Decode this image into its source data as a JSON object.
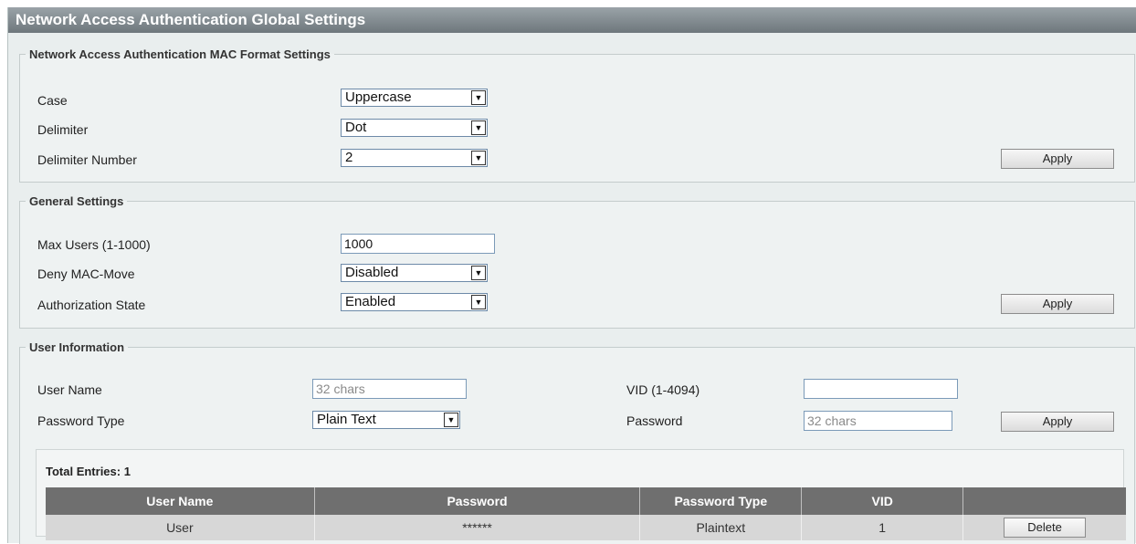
{
  "title": "Network Access Authentication Global Settings",
  "mac_format": {
    "legend": "Network Access Authentication MAC Format Settings",
    "case_label": "Case",
    "case_value": "Uppercase",
    "delimiter_label": "Delimiter",
    "delimiter_value": "Dot",
    "delimiter_number_label": "Delimiter Number",
    "delimiter_number_value": "2",
    "apply_label": "Apply"
  },
  "general": {
    "legend": "General Settings",
    "max_users_label": "Max Users (1-1000)",
    "max_users_value": "1000",
    "deny_mac_move_label": "Deny MAC-Move",
    "deny_mac_move_value": "Disabled",
    "authorization_state_label": "Authorization State",
    "authorization_state_value": "Enabled",
    "apply_label": "Apply"
  },
  "user_info": {
    "legend": "User Information",
    "user_name_label": "User Name",
    "user_name_placeholder": "32 chars",
    "vid_label": "VID (1-4094)",
    "vid_value": "",
    "password_type_label": "Password Type",
    "password_type_value": "Plain Text",
    "password_label": "Password",
    "password_placeholder": "32 chars",
    "apply_label": "Apply"
  },
  "table": {
    "total_entries": "Total Entries: 1",
    "headers": [
      "User Name",
      "Password",
      "Password Type",
      "VID",
      ""
    ],
    "rows": [
      {
        "user_name": "User",
        "password": "******",
        "password_type": "Plaintext",
        "vid": "1",
        "action": "Delete"
      }
    ]
  },
  "icons": {
    "dropdown_arrow": "chevron-down-icon"
  }
}
